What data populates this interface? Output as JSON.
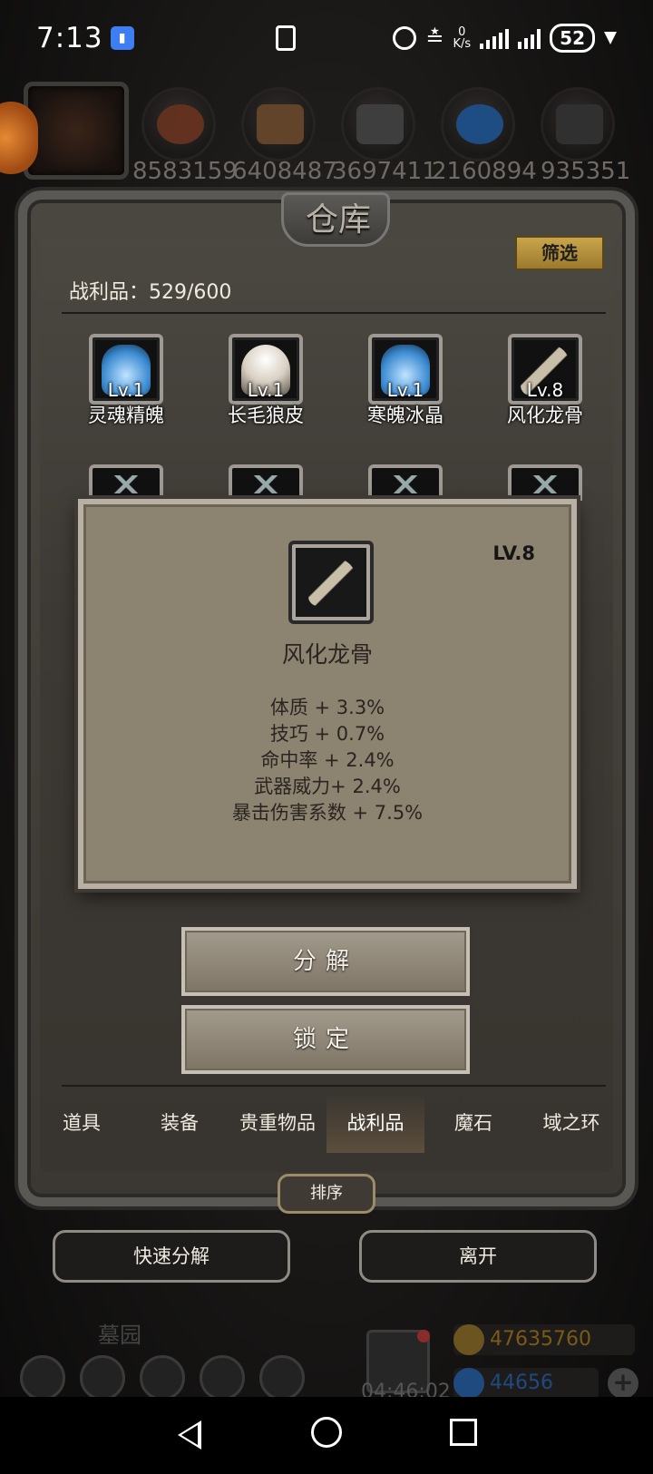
{
  "status_bar": {
    "time": "7:13",
    "net_speed_value": "0",
    "net_speed_unit": "K/s",
    "battery": "52"
  },
  "resources": [
    {
      "value": "8583159",
      "icon": "food-icon"
    },
    {
      "value": "6408487",
      "icon": "wood-icon"
    },
    {
      "value": "3697411",
      "icon": "iron-icon"
    },
    {
      "value": "2160894",
      "icon": "crystal-icon"
    },
    {
      "value": "935351",
      "icon": "ore-icon"
    }
  ],
  "warehouse": {
    "title": "仓库",
    "filter_label": "筛选",
    "trophy_count": "战利品：529/600",
    "items": [
      {
        "level": "Lv.1",
        "name": "灵魂精魄",
        "icon": "soul-essence-icon"
      },
      {
        "level": "Lv.1",
        "name": "长毛狼皮",
        "icon": "wolf-pelt-icon"
      },
      {
        "level": "Lv.1",
        "name": "寒魄冰晶",
        "icon": "ice-crystal-icon"
      },
      {
        "level": "Lv.8",
        "name": "风化龙骨",
        "icon": "dragon-bone-icon"
      }
    ]
  },
  "detail": {
    "level": "LV.8",
    "name": "风化龙骨",
    "stats": [
      "体质 + 3.3%",
      "技巧 + 0.7%",
      "命中率 + 2.4%",
      "武器威力+ 2.4%",
      "暴击伤害系数 + 7.5%"
    ]
  },
  "actions": {
    "decompose": "分解",
    "lock": "锁定"
  },
  "tabs": [
    {
      "label": "道具",
      "active": false
    },
    {
      "label": "装备",
      "active": false
    },
    {
      "label": "贵重物品",
      "active": false
    },
    {
      "label": "战利品",
      "active": true
    },
    {
      "label": "魔石",
      "active": false
    },
    {
      "label": "域之环",
      "active": false
    }
  ],
  "sort_label": "排序",
  "bottom_buttons": {
    "quick_decompose": "快速分解",
    "leave": "离开"
  },
  "hud": {
    "location": "墓园",
    "timer": "04:46:02",
    "gold": "47635760",
    "gems": "44656",
    "gold_color": "#7a5a16",
    "gem_color": "#1f4a80"
  }
}
